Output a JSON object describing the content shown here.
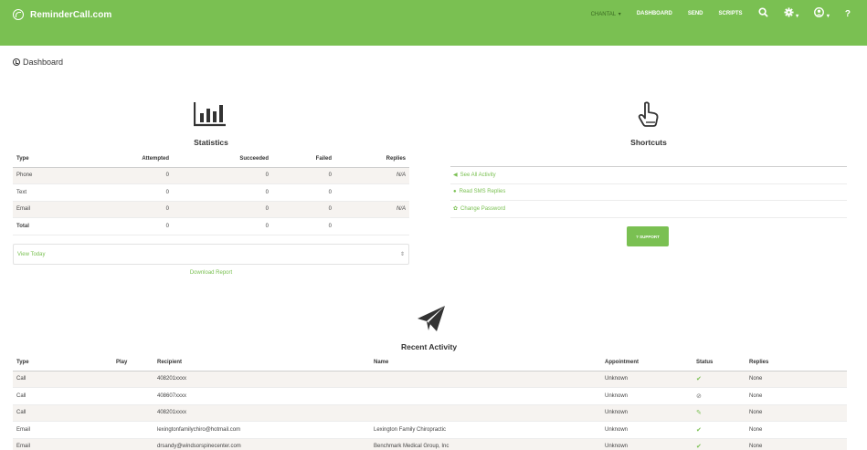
{
  "header": {
    "brand": "ReminderCall.com",
    "nav": {
      "user": "CHANTAL",
      "dashboard": "DASHBOARD",
      "send": "SEND",
      "scripts": "SCRIPTS"
    },
    "icons": [
      "search-icon",
      "gear-icon",
      "user-circle-icon",
      "help-icon"
    ]
  },
  "page": {
    "title": "Dashboard"
  },
  "statistics": {
    "heading": "Statistics",
    "icon": "bar-chart-icon",
    "columns": [
      "Type",
      "Attempted",
      "Succeeded",
      "Failed",
      "Replies"
    ],
    "rows": [
      {
        "type": "Phone",
        "attempted": "0",
        "succeeded": "0",
        "failed": "0",
        "replies": "N/A"
      },
      {
        "type": "Text",
        "attempted": "0",
        "succeeded": "0",
        "failed": "0",
        "replies": ""
      },
      {
        "type": "Email",
        "attempted": "0",
        "succeeded": "0",
        "failed": "0",
        "replies": "N/A"
      },
      {
        "type": "Total",
        "attempted": "0",
        "succeeded": "0",
        "failed": "0",
        "replies": ""
      }
    ],
    "period_select": "View Today",
    "download_label": "Download Report"
  },
  "shortcuts": {
    "heading": "Shortcuts",
    "icon": "pointing-hand-icon",
    "items": [
      {
        "label": "See All Activity",
        "icon": "send-icon"
      },
      {
        "label": "Read SMS Replies",
        "icon": "chat-icon"
      },
      {
        "label": "Change Password",
        "icon": "gear-icon"
      }
    ],
    "support_label": "? SUPPORT"
  },
  "activity": {
    "heading": "Recent Activity",
    "icon": "paper-plane-icon",
    "columns": [
      "Type",
      "Play",
      "Recipient",
      "Name",
      "Appointment",
      "Status",
      "Replies"
    ],
    "rows": [
      {
        "type": "Call",
        "play": "",
        "recipient": "408201xxxx",
        "name": "",
        "appointment": "Unknown",
        "status": "check",
        "replies": "None"
      },
      {
        "type": "Call",
        "play": "",
        "recipient": "408607xxxx",
        "name": "",
        "appointment": "Unknown",
        "status": "ban",
        "replies": "None"
      },
      {
        "type": "Call",
        "play": "",
        "recipient": "408201xxxx",
        "name": "",
        "appointment": "Unknown",
        "status": "edit",
        "replies": "None"
      },
      {
        "type": "Email",
        "play": "",
        "recipient": "lexingtonfamilychiro@hotmail.com",
        "name": "Lexington Family Chiropractic",
        "appointment": "Unknown",
        "status": "check",
        "replies": "None"
      },
      {
        "type": "Email",
        "play": "",
        "recipient": "drsandy@windsorspinecenter.com",
        "name": "Benchmark Medical Group, Inc",
        "appointment": "Unknown",
        "status": "check",
        "replies": "None"
      }
    ]
  },
  "colors": {
    "brand_green": "#7ac052",
    "row_alt": "#f6f3f0"
  }
}
